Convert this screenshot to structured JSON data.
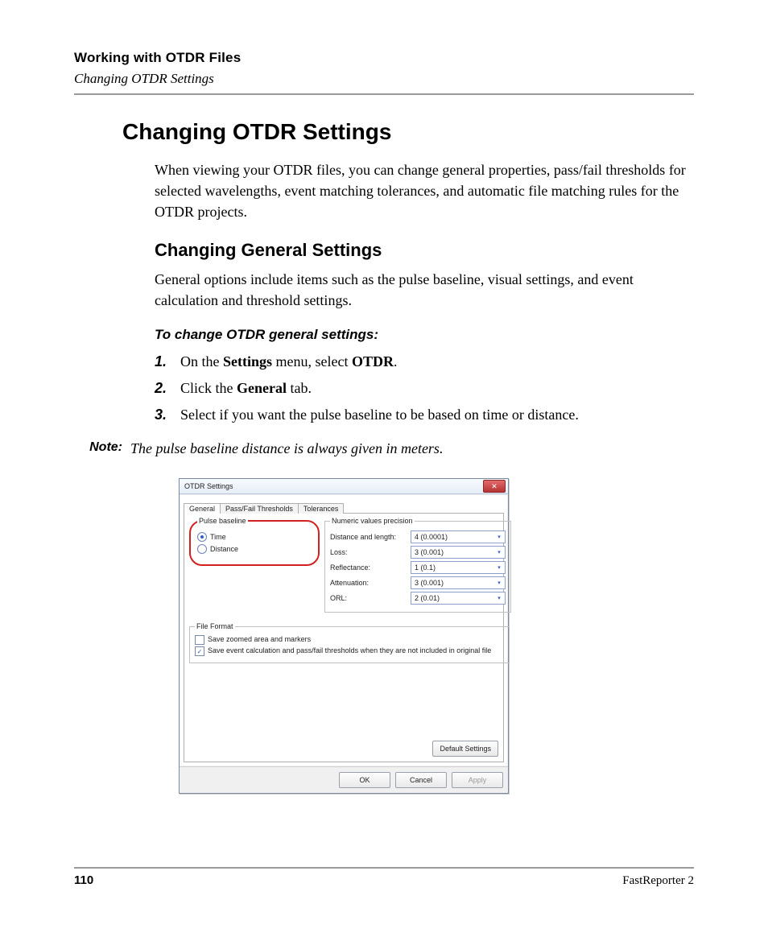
{
  "header": {
    "chapter": "Working with OTDR Files",
    "section": "Changing OTDR Settings"
  },
  "h1": "Changing OTDR Settings",
  "intro": "When viewing your OTDR files, you can change general properties, pass/fail thresholds for selected wavelengths, event matching tolerances, and automatic file matching rules for the OTDR projects.",
  "h2": "Changing General Settings",
  "p2": "General options include items such as the pulse baseline, visual settings, and event calculation and threshold settings.",
  "proc_title": "To change OTDR general settings:",
  "steps": {
    "s1_a": "On the ",
    "s1_b": "Settings",
    "s1_c": " menu, select ",
    "s1_d": "OTDR",
    "s1_e": ".",
    "s2_a": "Click the ",
    "s2_b": "General",
    "s2_c": " tab.",
    "s3": "Select if you want the pulse baseline to be based on time or distance."
  },
  "nums": {
    "n1": "1.",
    "n2": "2.",
    "n3": "3."
  },
  "note_label": "Note:",
  "note_text": "The pulse baseline distance is always given in meters.",
  "dialog": {
    "title": "OTDR Settings",
    "close_glyph": "✕",
    "tabs": {
      "general": "General",
      "pft": "Pass/Fail Thresholds",
      "tol": "Tolerances"
    },
    "pulse_legend": "Pulse baseline",
    "radio_time": "Time",
    "radio_distance": "Distance",
    "nvp_legend": "Numeric values precision",
    "rows": {
      "dl_k": "Distance and length:",
      "dl_v": "4 (0.0001)",
      "loss_k": "Loss:",
      "loss_v": "3 (0.001)",
      "refl_k": "Reflectance:",
      "refl_v": "1 (0.1)",
      "att_k": "Attenuation:",
      "att_v": "3 (0.001)",
      "orl_k": "ORL:",
      "orl_v": "2 (0.01)"
    },
    "ff_legend": "File Format",
    "ck1": "Save zoomed area and markers",
    "ck2": "Save event calculation and pass/fail thresholds when they are not included in original file",
    "check_glyph": "✓",
    "default_btn": "Default Settings",
    "ok": "OK",
    "cancel": "Cancel",
    "apply": "Apply"
  },
  "footer": {
    "page": "110",
    "product": "FastReporter 2"
  }
}
